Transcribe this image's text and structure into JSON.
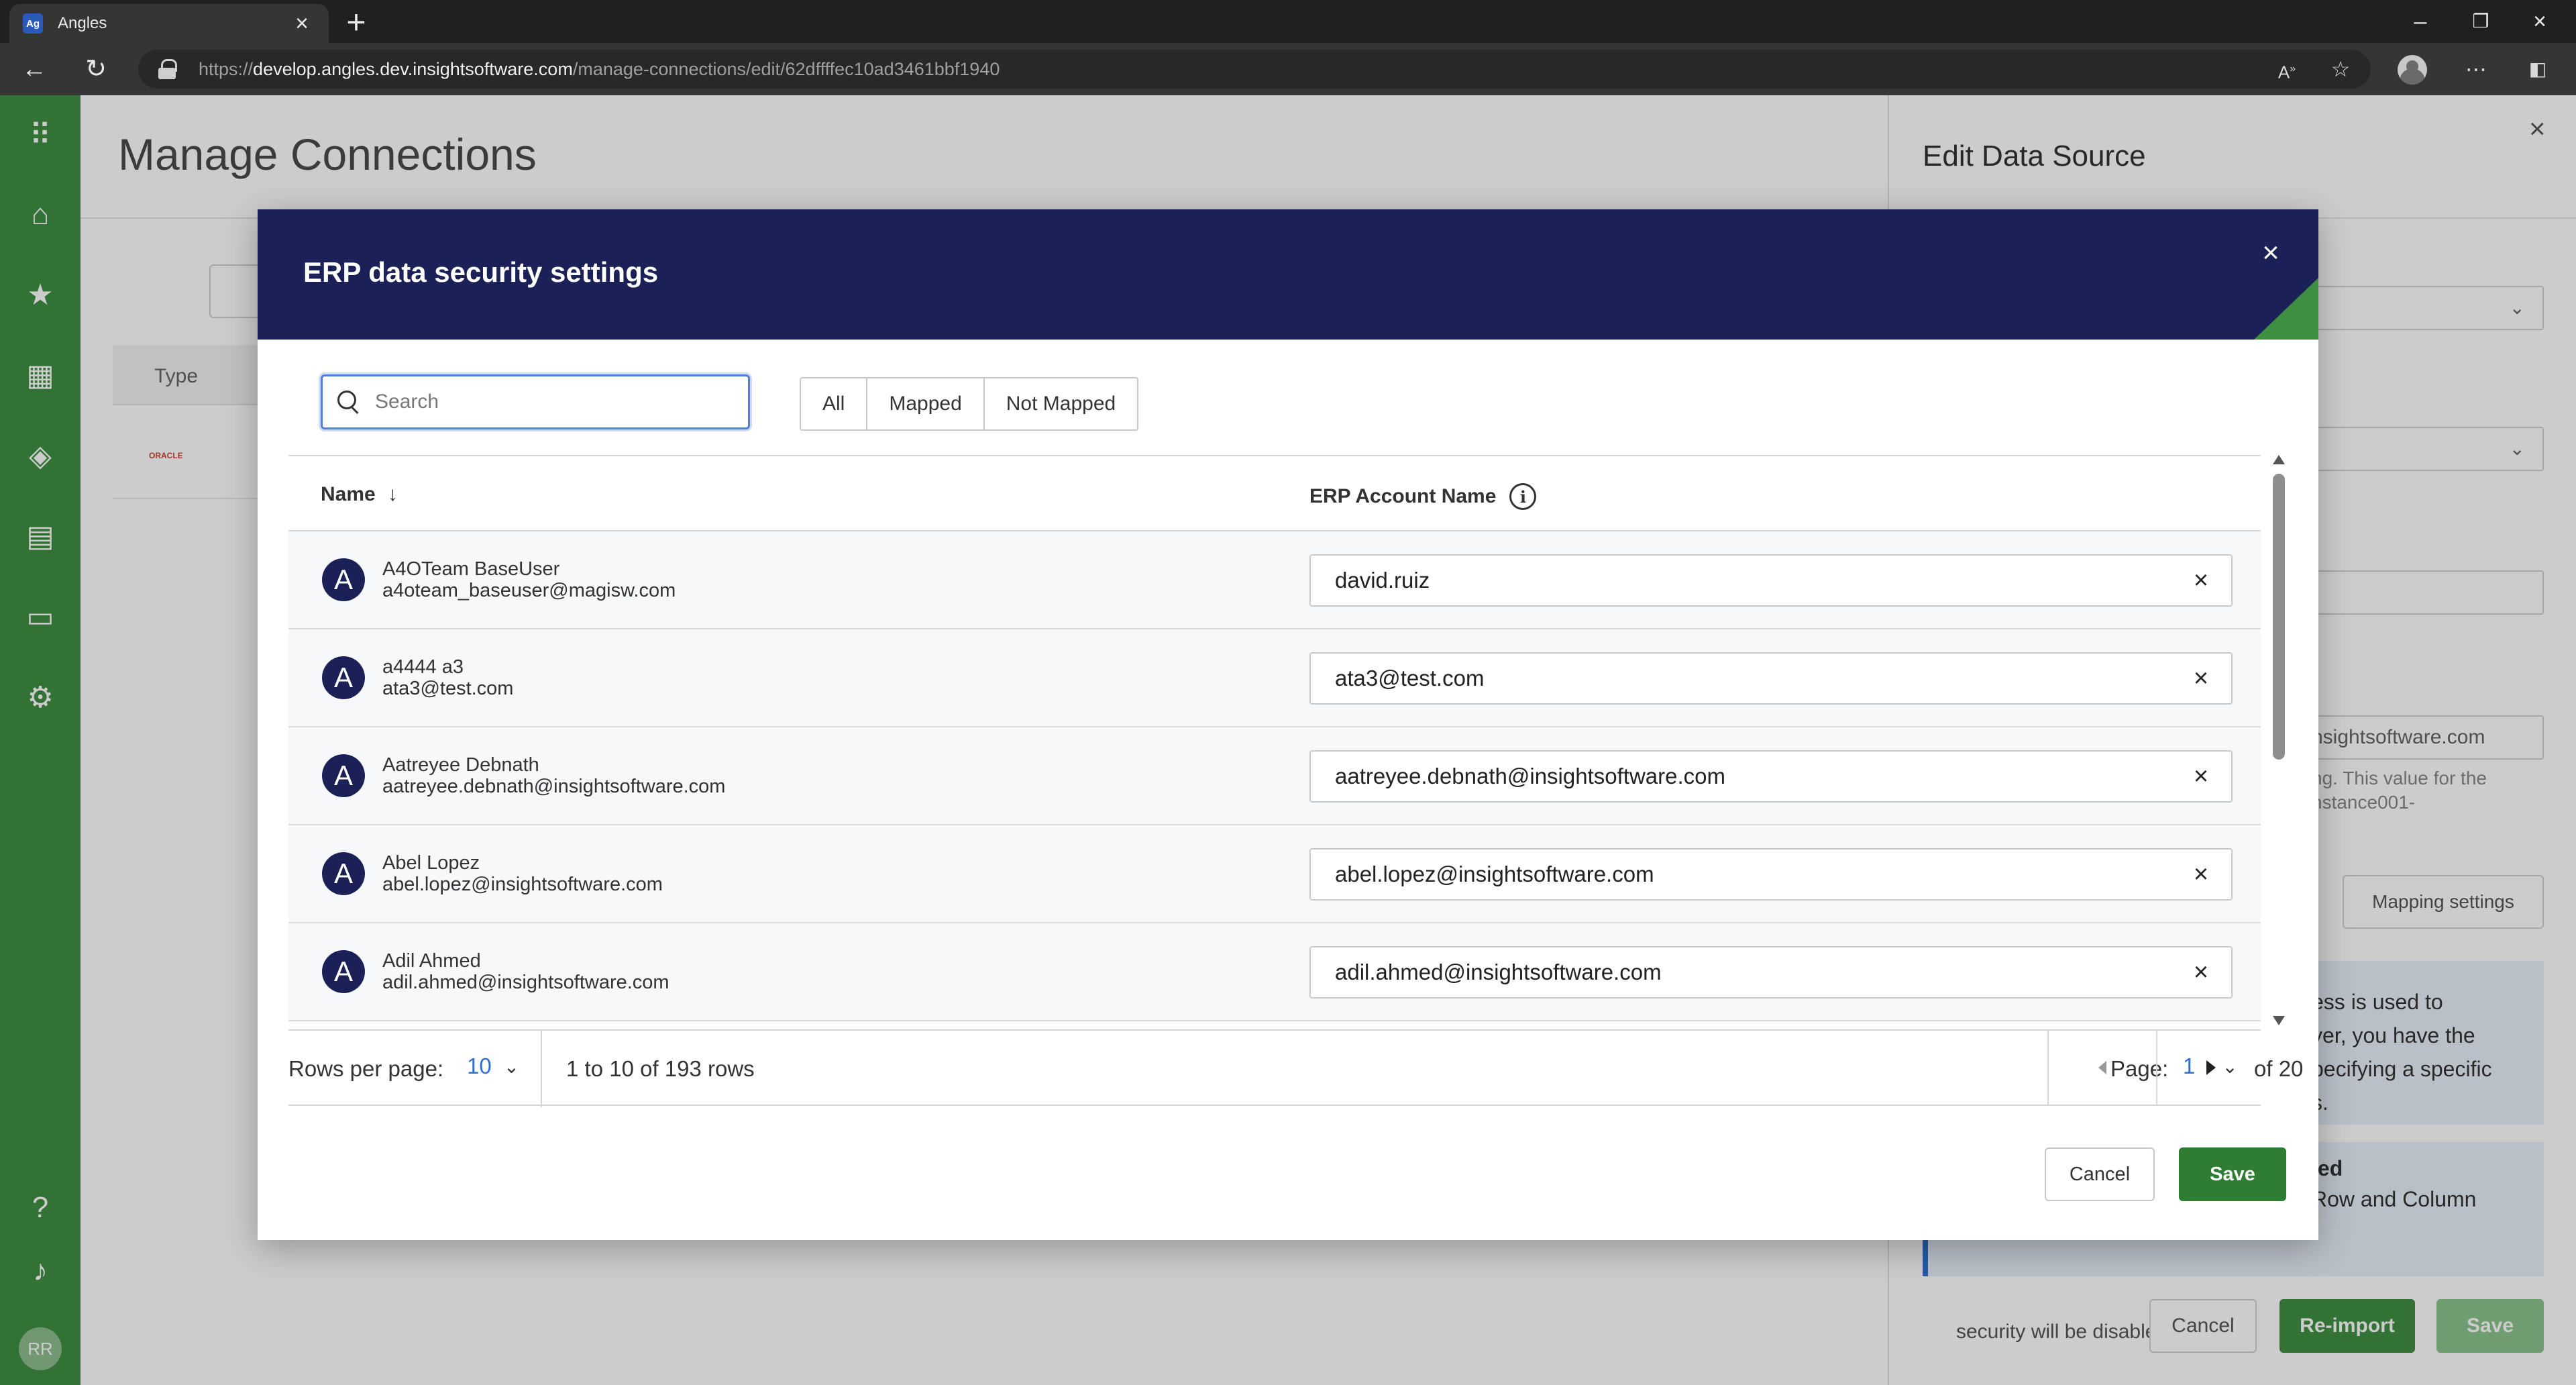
{
  "browser": {
    "tab_title": "Angles",
    "tab_favicon_text": "Ag",
    "url_prefix": "https://",
    "url_host": "develop.angles.dev.insightsoftware.com",
    "url_path": "/manage-connections/edit/62dffffec10ad3461bbf1940"
  },
  "app": {
    "page_title": "Manage Connections",
    "background_table": {
      "type_header": "Type",
      "row_logo_text": "ORACLE"
    },
    "nav": {
      "avatar_initials": "RR"
    }
  },
  "side_panel": {
    "title": "Edit Data Source",
    "field_partial_value": "nsightsoftware.com",
    "help_partial": "ng. This value for the\nnstance001-",
    "mapping_settings_label": "Mapping settings",
    "info1_partial": "ess is used to\nver, you have the\npecifying a specific\ns.",
    "info2_title_partial": "led",
    "info2_partial": "Row and Column",
    "info2_cut": "security will be disabled.",
    "cancel_label": "Cancel",
    "reimport_label": "Re-import",
    "save_label": "Save",
    "colors": {
      "primary_green": "#3f8f42",
      "info_blue": "#2f6fd1"
    }
  },
  "modal": {
    "title": "ERP data security settings",
    "search_placeholder": "Search",
    "filters": [
      "All",
      "Mapped",
      "Not Mapped"
    ],
    "columns": {
      "name": "Name",
      "erp_account_name": "ERP Account Name"
    },
    "rows": [
      {
        "initial": "A",
        "name": "A4OTeam BaseUser",
        "email": "a4oteam_baseuser@magisw.com",
        "erp_account": "david.ruiz"
      },
      {
        "initial": "A",
        "name": "a4444 a3",
        "email": "ata3@test.com",
        "erp_account": "ata3@test.com"
      },
      {
        "initial": "A",
        "name": "Aatreyee Debnath",
        "email": "aatreyee.debnath@insightsoftware.com",
        "erp_account": "aatreyee.debnath@insightsoftware.com"
      },
      {
        "initial": "A",
        "name": "Abel Lopez",
        "email": "abel.lopez@insightsoftware.com",
        "erp_account": "abel.lopez@insightsoftware.com"
      },
      {
        "initial": "A",
        "name": "Adil Ahmed",
        "email": "adil.ahmed@insightsoftware.com",
        "erp_account": "adil.ahmed@insightsoftware.com"
      }
    ],
    "pagination": {
      "rows_per_page_label": "Rows per page:",
      "rows_per_page": "10",
      "range_text": "1 to 10 of 193 rows",
      "page_label": "Page:",
      "page": "1",
      "of_text": "of 20"
    },
    "cancel_label": "Cancel",
    "save_label": "Save",
    "colors": {
      "header_bg": "#1b2157",
      "save_bg": "#2e7d32",
      "accent_blue": "#2f6fd1"
    }
  }
}
